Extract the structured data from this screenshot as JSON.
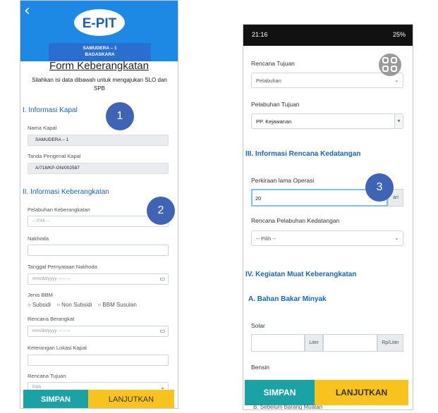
{
  "left": {
    "back_glyph": "‹",
    "logo_text": "E-PIT",
    "vessel_name": "SAMUDERA – 1",
    "vessel_sub": "BAGASKARA",
    "form_title": "Form Keberangkatan",
    "form_subtitle": "Silahkan isi data dibawah untuk mengajukan SLO dan SPB",
    "section_kapal": "I. Informasi Kapal",
    "nama_kapal_label": "Nama Kapal",
    "nama_kapal_value": "SAMUDERA – 1",
    "tanda_label": "Tanda Pengenal Kapal",
    "tanda_value": "A/718/KP-GN/002587",
    "section_keberangkatan": "II. Informasi Keberangkatan",
    "pelabuhan_label": "Pelabuhan Keberangkatan",
    "pelabuhan_value": "-- Pilih --",
    "nakhoda_label": "Nakhoda",
    "tgl_label": "Tanggal Pernyataan Nakhoda",
    "tgl_placeholder": "mm/dd/yyyy --:-- --",
    "bbm_label": "Jenis BBM",
    "bbm_options": [
      "Subsidi",
      "Non Subsidi",
      "BBM Susulan"
    ],
    "berangkat_label": "Rencana Berangkat",
    "berangkat_placeholder": "mm/dd/yyyy --:-- --",
    "lokasi_label": "Keterangan Lokasi Kapal",
    "tujuan_label": "Rencana Tujuan",
    "tujuan_value": "Pilih",
    "btn_simpan": "SIMPAN",
    "btn_lanjutkan": "LANJUTKAN"
  },
  "badges": [
    "1",
    "2",
    "3"
  ],
  "right": {
    "status_time": "21:16",
    "status_battery": "25%",
    "rencana_tujuan_label": "Rencana Tujuan",
    "rencana_tujuan_value": "Pelabuhan",
    "pelabuhan_tujuan_label": "Pelabuhan Tujuan",
    "pelabuhan_tujuan_value": "PP. Kejawanan",
    "section_kedatangan": "III. Informasi Rencana Kedatangan",
    "lama_operasi_label": "Perkiraan lama Operasi",
    "lama_operasi_value": "20",
    "lama_operasi_unit": "ari",
    "pelabuhan_kedatangan_label": "Rencana Pelabuhan Kedatangan",
    "pelabuhan_kedatangan_value": "-- Pilih --",
    "section_muat": "IV. Kegiatan Muat Keberangkatan",
    "subsection_bbm": "A. Bahan Bakar Minyak",
    "solar_label": "Solar",
    "liter_unit": "Liter",
    "price_unit": "Rp/Liter",
    "bensin_label": "Bensin",
    "btn_simpan": "SIMPAN",
    "btn_lanjutkan": "LANJUTKAN",
    "peek_text": "B. Sebelum Barang Muatan"
  },
  "colors": {
    "header_blue": "#1e88e5",
    "section_blue": "#1565c0",
    "teal": "#1ba2a4",
    "yellow": "#f9c31d",
    "badge": "#3f63b5"
  }
}
